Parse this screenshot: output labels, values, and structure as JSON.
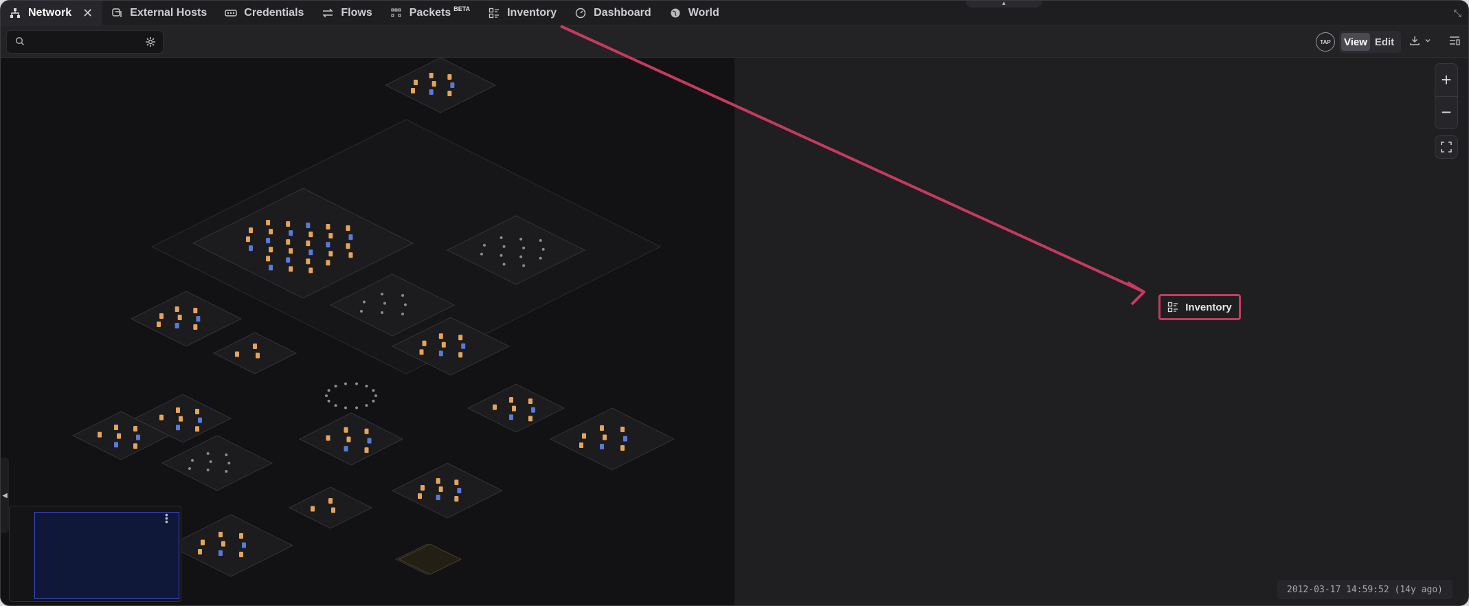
{
  "tabs": [
    {
      "label": "Network",
      "icon": "network-icon",
      "active": true,
      "closable": true
    },
    {
      "label": "External Hosts",
      "icon": "external-hosts-icon"
    },
    {
      "label": "Credentials",
      "icon": "credentials-icon"
    },
    {
      "label": "Flows",
      "icon": "flows-icon"
    },
    {
      "label": "Packets",
      "badge": "BETA",
      "icon": "packets-icon"
    },
    {
      "label": "Inventory",
      "icon": "inventory-icon"
    },
    {
      "label": "Dashboard",
      "icon": "dashboard-icon"
    },
    {
      "label": "World",
      "icon": "world-icon"
    }
  ],
  "toolbar": {
    "search_placeholder": "",
    "tap_label": "TAP",
    "view_label": "View",
    "edit_label": "Edit",
    "view_active": true
  },
  "callout": {
    "label": "Inventory",
    "icon": "inventory-icon",
    "color": "#c73a5f"
  },
  "zoom": {
    "in": "+",
    "out": "−"
  },
  "timestamp": "2012-03-17 14:59:52 (14y ago)",
  "colors": {
    "accent": "#c73a5f",
    "canvas_bg": "#121214",
    "node_orange": "#e6a45a",
    "node_blue": "#5a7ad8",
    "minimap_viewport": "#3a4ad0"
  }
}
